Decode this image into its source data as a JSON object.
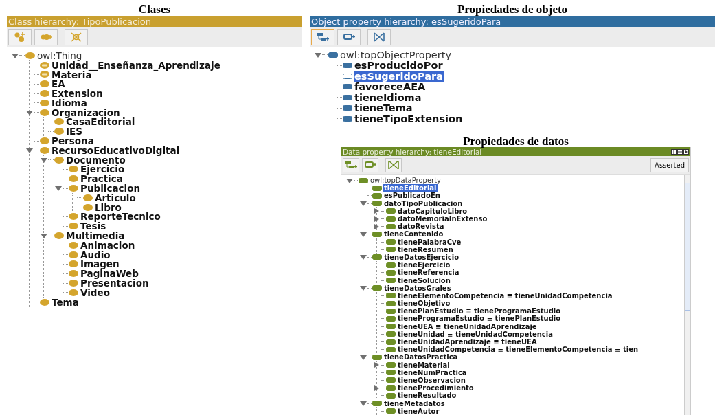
{
  "classes": {
    "heading": "Clases",
    "kind": "class",
    "title": "Class hierarchy: TipoPublicacion",
    "tree": [
      {
        "label": "owl:Thing",
        "expanded": true,
        "selected": false,
        "children": [
          {
            "label": "Unidad__Enseñanza_Aprendizaje",
            "kind": "defined",
            "selected": false
          },
          {
            "label": "Materia",
            "kind": "defined",
            "selected": false
          },
          {
            "label": "EA",
            "selected": false
          },
          {
            "label": "Extension",
            "selected": false
          },
          {
            "label": "Idioma",
            "selected": false
          },
          {
            "label": "Organizacion",
            "expanded": true,
            "selected": false,
            "children": [
              {
                "label": "CasaEditorial",
                "selected": false
              },
              {
                "label": "IES",
                "selected": false
              }
            ]
          },
          {
            "label": "Persona",
            "selected": false
          },
          {
            "label": "RecursoEducativoDigital",
            "expanded": true,
            "selected": false,
            "children": [
              {
                "label": "Documento",
                "expanded": true,
                "selected": false,
                "children": [
                  {
                    "label": "Ejercicio",
                    "selected": false
                  },
                  {
                    "label": "Practica",
                    "selected": false
                  },
                  {
                    "label": "Publicacion",
                    "expanded": true,
                    "selected": false,
                    "children": [
                      {
                        "label": "Articulo",
                        "selected": false
                      },
                      {
                        "label": "Libro",
                        "selected": false
                      }
                    ]
                  },
                  {
                    "label": "ReporteTecnico",
                    "selected": false
                  },
                  {
                    "label": "Tesis",
                    "selected": false
                  }
                ]
              },
              {
                "label": "Multimedia",
                "expanded": true,
                "selected": false,
                "children": [
                  {
                    "label": "Animacion",
                    "selected": false
                  },
                  {
                    "label": "Audio",
                    "selected": false
                  },
                  {
                    "label": "Imagen",
                    "selected": false
                  },
                  {
                    "label": "PaginaWeb",
                    "selected": false
                  },
                  {
                    "label": "Presentacion",
                    "selected": false
                  },
                  {
                    "label": "Video",
                    "selected": false
                  }
                ]
              }
            ]
          },
          {
            "label": "Tema",
            "selected": false
          }
        ]
      }
    ]
  },
  "object_properties": {
    "heading": "Propiedades de objeto",
    "kind": "object",
    "title": "Object property hierarchy: esSugeridoPara",
    "tree": [
      {
        "label": "owl:topObjectProperty",
        "expanded": true,
        "selected": false,
        "children": [
          {
            "label": "esProducidoPor",
            "selected": false
          },
          {
            "label": "esSugeridoPara",
            "selected": true
          },
          {
            "label": "favoreceAEA",
            "selected": false
          },
          {
            "label": "tieneIdioma",
            "selected": false
          },
          {
            "label": "tieneTema",
            "selected": false
          },
          {
            "label": "tieneTipoExtension",
            "selected": false
          }
        ]
      }
    ]
  },
  "data_properties": {
    "heading": "Propiedades de datos",
    "kind": "data",
    "title": "Data property hierarchy: tieneEditorial",
    "view_button": "Asserted",
    "tree": [
      {
        "label": "owl:topDataProperty",
        "expanded": true,
        "selected": false,
        "children": [
          {
            "label": "tieneEditorial",
            "selected": true
          },
          {
            "label": "esPublicadoEn",
            "selected": false
          },
          {
            "label": "datoTipoPublicacion",
            "expanded": true,
            "selected": false,
            "children": [
              {
                "label": "datoCapituloLibro",
                "expanded": false,
                "selected": false
              },
              {
                "label": "datoMemoriaInExtenso",
                "expanded": false,
                "selected": false
              },
              {
                "label": "datoRevista",
                "expanded": false,
                "selected": false
              }
            ]
          },
          {
            "label": "tieneContenido",
            "expanded": true,
            "selected": false,
            "children": [
              {
                "label": "tienePalabraCve",
                "selected": false
              },
              {
                "label": "tieneResumen",
                "selected": false
              }
            ]
          },
          {
            "label": "tieneDatosEjercicio",
            "expanded": true,
            "selected": false,
            "children": [
              {
                "label": "tieneEjercicio",
                "selected": false
              },
              {
                "label": "tieneReferencia",
                "selected": false
              },
              {
                "label": "tieneSolucion",
                "selected": false
              }
            ]
          },
          {
            "label": "tieneDatosGrales",
            "expanded": true,
            "selected": false,
            "children": [
              {
                "label": "tieneElementoCompetencia ≡ tieneUnidadCompetencia",
                "selected": false
              },
              {
                "label": "tieneObjetivo",
                "selected": false
              },
              {
                "label": "tienePlanEstudio ≡ tieneProgramaEstudio",
                "selected": false
              },
              {
                "label": "tieneProgramaEstudio ≡ tienePlanEstudio",
                "selected": false
              },
              {
                "label": "tieneUEA ≡ tieneUnidadAprendizaje",
                "selected": false
              },
              {
                "label": "tieneUnidad ≡ tieneUnidadCompetencia",
                "selected": false
              },
              {
                "label": "tieneUnidadAprendizaje ≡ tieneUEA",
                "selected": false
              },
              {
                "label": "tieneUnidadCompetencia ≡ tieneElementoCompetencia ≡ tien",
                "selected": false
              }
            ]
          },
          {
            "label": "tieneDatosPractica",
            "expanded": true,
            "selected": false,
            "children": [
              {
                "label": "tieneMaterial",
                "expanded": false,
                "selected": false
              },
              {
                "label": "tieneNumPractica",
                "selected": false
              },
              {
                "label": "tieneObservacion",
                "selected": false
              },
              {
                "label": "tieneProcedimiento",
                "expanded": false,
                "selected": false
              },
              {
                "label": "tieneResultado",
                "selected": false
              }
            ]
          },
          {
            "label": "tieneMetadatos",
            "expanded": true,
            "selected": false,
            "children": [
              {
                "label": "tieneAutor",
                "selected": false
              }
            ]
          }
        ]
      }
    ]
  }
}
